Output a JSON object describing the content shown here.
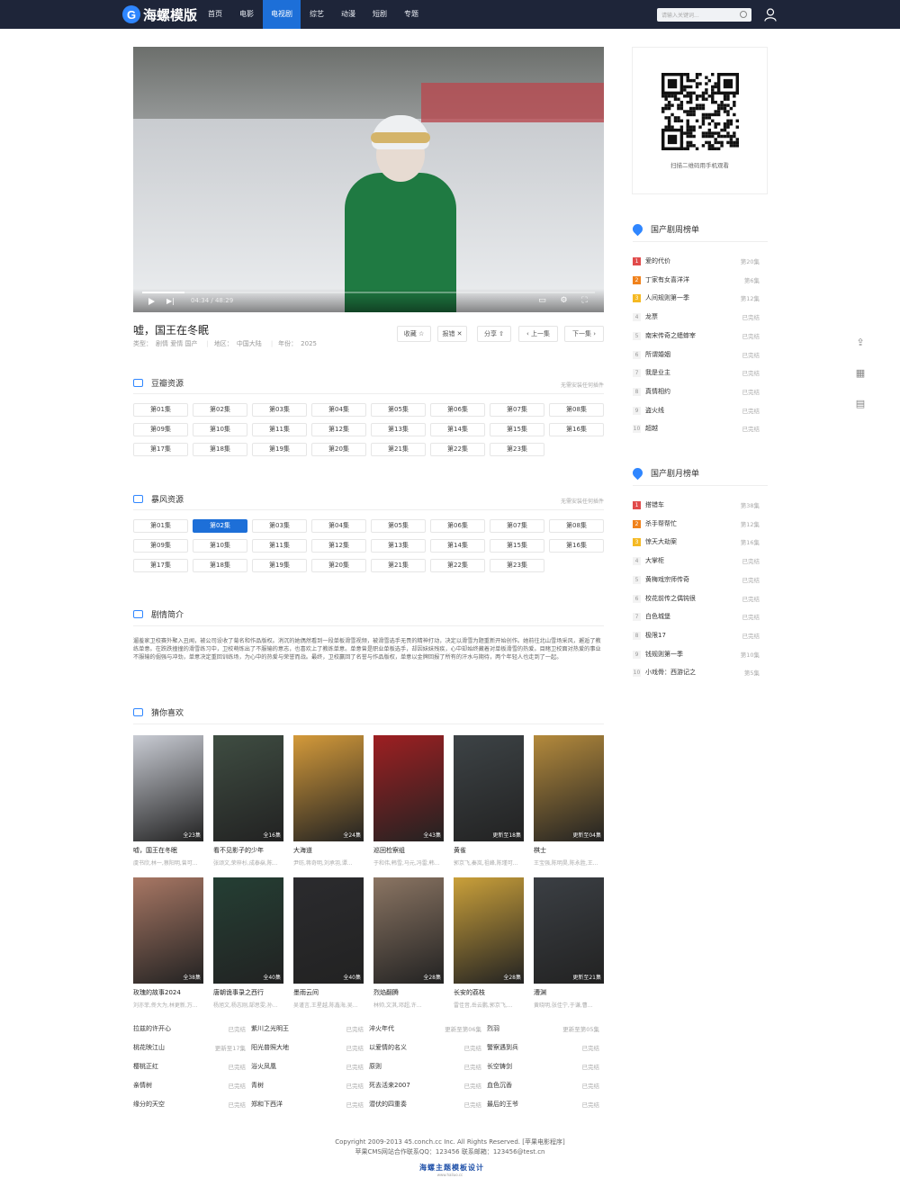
{
  "brand": {
    "name": "海螺模版",
    "mark": "G"
  },
  "nav": [
    "首页",
    "电影",
    "电视剧",
    "综艺",
    "动漫",
    "短剧",
    "专题"
  ],
  "nav_active": 2,
  "search": {
    "placeholder": "请输入关键词..."
  },
  "player": {
    "time": "04:34 / 48:29",
    "progress": 0.094
  },
  "detail": {
    "title": "嘘，国王在冬眠",
    "type_label": "类型：",
    "type": "剧情 爱情 国产",
    "area_label": "地区：",
    "area": "中国大陆",
    "year_label": "年份：",
    "year": "2025",
    "actions": [
      "收藏 ☆",
      "报错 ✕",
      "分享 ⇧",
      "‹ 上一集",
      "下一集 ›"
    ]
  },
  "sources": [
    {
      "title": "豆瓣资源",
      "note": "无需安装任何插件",
      "episodes": [
        "第01集",
        "第02集",
        "第03集",
        "第04集",
        "第05集",
        "第06集",
        "第07集",
        "第08集",
        "第09集",
        "第10集",
        "第11集",
        "第12集",
        "第13集",
        "第14集",
        "第15集",
        "第16集",
        "第17集",
        "第18集",
        "第19集",
        "第20集",
        "第21集",
        "第22集",
        "第23集"
      ],
      "active": -1
    },
    {
      "title": "暴风资源",
      "note": "无需安装任何插件",
      "episodes": [
        "第01集",
        "第02集",
        "第03集",
        "第04集",
        "第05集",
        "第06集",
        "第07集",
        "第08集",
        "第09集",
        "第10集",
        "第11集",
        "第12集",
        "第13集",
        "第14集",
        "第15集",
        "第16集",
        "第17集",
        "第18集",
        "第19集",
        "第20集",
        "第21集",
        "第22集",
        "第23集"
      ],
      "active": 1
    }
  ],
  "intro": {
    "title": "剧情简介",
    "text": "遛羞家卫校赛外聚入丑闻，被公司设收了菊名和作品版权。消沉的她偶然看到一段单板滑雪视频，被滑雪选手无畏的精神打动，决定以滑雪为题重新开始创作。她前往北山雪场采风，邂逅了教练单意。在跌跌撞撞的滑雪练习中，卫校萌炼出了不服输的意志，也喜欢上了教练单意。单意曾是职业单板选手，却因妹妹残疾，心中却始终藏着对单板滑雪的热爱。目睹卫校面对热爱的事业不服输的倔强与冲劲，单意决定重回训练场，为心中的热爱与荣誉而战。最终，卫校赢回了名誉与作品版权，单意以金牌回报了所有的汗水与期待，两个年轻人也走到了一起。"
  },
  "recommend": {
    "title": "猜你喜欢",
    "items": [
      {
        "title": "嘘，国王在冬眠",
        "actors": "虞书欣,林一,蔡阳明,曾可...",
        "badge": "全23集",
        "color": "#c9ccd4"
      },
      {
        "title": "看不见影子的少年",
        "actors": "张颂文,荣梓杉,成泰燊,陈...",
        "badge": "全16集",
        "color": "#3f4d42"
      },
      {
        "title": "大海道",
        "actors": "尹昉,蒋奇明,刘承羽,谭...",
        "badge": "全24集",
        "color": "#d49a3a"
      },
      {
        "title": "巡回检察组",
        "actors": "于和伟,韩雪,马元,冯雷,韩...",
        "badge": "全43集",
        "color": "#9e1f22"
      },
      {
        "title": "黄雀",
        "actors": "郭京飞,秦岚,祖峰,陈瑾可...",
        "badge": "更新至18集",
        "color": "#3d4346"
      },
      {
        "title": "棋士",
        "actors": "王宝强,陈明昊,陈永胜,王...",
        "badge": "更新至04集",
        "color": "#b48a3c"
      },
      {
        "title": "玫瑰的故事2024",
        "actors": "刘亦菲,佟大为,林更新,万...",
        "badge": "全38集",
        "color": "#a87764"
      },
      {
        "title": "唐朝诡事录之西行",
        "actors": "杨旭文,杨志刚,郜思雯,孙...",
        "badge": "全40集",
        "color": "#243f34"
      },
      {
        "title": "墨雨云间",
        "actors": "吴谨言,王星越,陈鑫海,吴...",
        "badge": "全40集",
        "color": "#2b2b2e"
      },
      {
        "title": "烈焰翻腾",
        "actors": "林帅,文淇,邓超,许...",
        "badge": "全28集",
        "color": "#8b7563"
      },
      {
        "title": "长安的荔枝",
        "actors": "雷佳音,岳云鹏,郭京飞,...",
        "badge": "全28集",
        "color": "#caa03a"
      },
      {
        "title": "漕渊",
        "actors": "黄晓明,张佳宁,于谦,曹...",
        "badge": "更新至21集",
        "color": "#3b3f44"
      }
    ]
  },
  "text_list": [
    {
      "name": "拉兹的许开心",
      "stat": "已完结"
    },
    {
      "name": "紫川之光明王",
      "stat": "已完结"
    },
    {
      "name": "淬火年代",
      "stat": "更新至第06集"
    },
    {
      "name": "烈羽",
      "stat": "更新至第05集"
    },
    {
      "name": "桃花映江山",
      "stat": "更新至17集"
    },
    {
      "name": "阳光普照大地",
      "stat": "已完结"
    },
    {
      "name": "以爱情的名义",
      "stat": "已完结"
    },
    {
      "name": "警察遇到兵",
      "stat": "已完结"
    },
    {
      "name": "樱桃正红",
      "stat": "已完结"
    },
    {
      "name": "浴火凤凰",
      "stat": "已完结"
    },
    {
      "name": "原则",
      "stat": "已完结"
    },
    {
      "name": "长空铸剑",
      "stat": "已完结"
    },
    {
      "name": "亲情树",
      "stat": "已完结"
    },
    {
      "name": "青树",
      "stat": "已完结"
    },
    {
      "name": "死去活来2007",
      "stat": "已完结"
    },
    {
      "name": "血色沉香",
      "stat": "已完结"
    },
    {
      "name": "缘分的天空",
      "stat": "已完结"
    },
    {
      "name": "郑和下西洋",
      "stat": "已完结"
    },
    {
      "name": "潜伏的四重奏",
      "stat": "已完结"
    },
    {
      "name": "最后的王爷",
      "stat": "已完结"
    }
  ],
  "qr": {
    "caption": "扫描二维码用手机观看"
  },
  "rank_weekly": {
    "title": "国产剧周榜单",
    "items": [
      {
        "name": "爱的代价",
        "stat": "第20集"
      },
      {
        "name": "丁家有女喜洋洋",
        "stat": "第6集"
      },
      {
        "name": "人间规则第一季",
        "stat": "第12集"
      },
      {
        "name": "龙票",
        "stat": "已完结"
      },
      {
        "name": "南宋传奇之蟋蟀宰",
        "stat": "已完结"
      },
      {
        "name": "所谓婚姻",
        "stat": "已完结"
      },
      {
        "name": "我是业主",
        "stat": "已完结"
      },
      {
        "name": "真情相约",
        "stat": "已完结"
      },
      {
        "name": "盗火线",
        "stat": "已完结"
      },
      {
        "name": "超越",
        "stat": "已完结"
      }
    ]
  },
  "rank_monthly": {
    "title": "国产剧月榜单",
    "items": [
      {
        "name": "搭错车",
        "stat": "第38集"
      },
      {
        "name": "杀手帮帮忙",
        "stat": "第12集"
      },
      {
        "name": "惊天大劫案",
        "stat": "第16集"
      },
      {
        "name": "大掌柜",
        "stat": "已完结"
      },
      {
        "name": "黄梅戏宗师传奇",
        "stat": "已完结"
      },
      {
        "name": "校花前传之偶钝很",
        "stat": "已完结"
      },
      {
        "name": "白色城堡",
        "stat": "已完结"
      },
      {
        "name": "极限17",
        "stat": "已完结"
      },
      {
        "name": "钱规则第一季",
        "stat": "第10集"
      },
      {
        "name": "小戏骨：西游记之",
        "stat": "第5集"
      }
    ]
  },
  "footer": {
    "line1": "Copyright 2009-2013 45.conch.cc Inc. All Rights Reserved. [苹果电影程序]",
    "line2": "苹果CMS网站合作联系QQ：123456 联系邮箱：123456@test.cn",
    "logo": "海螺主题模板设计",
    "logo_sub": "www.hailuo.cc"
  }
}
